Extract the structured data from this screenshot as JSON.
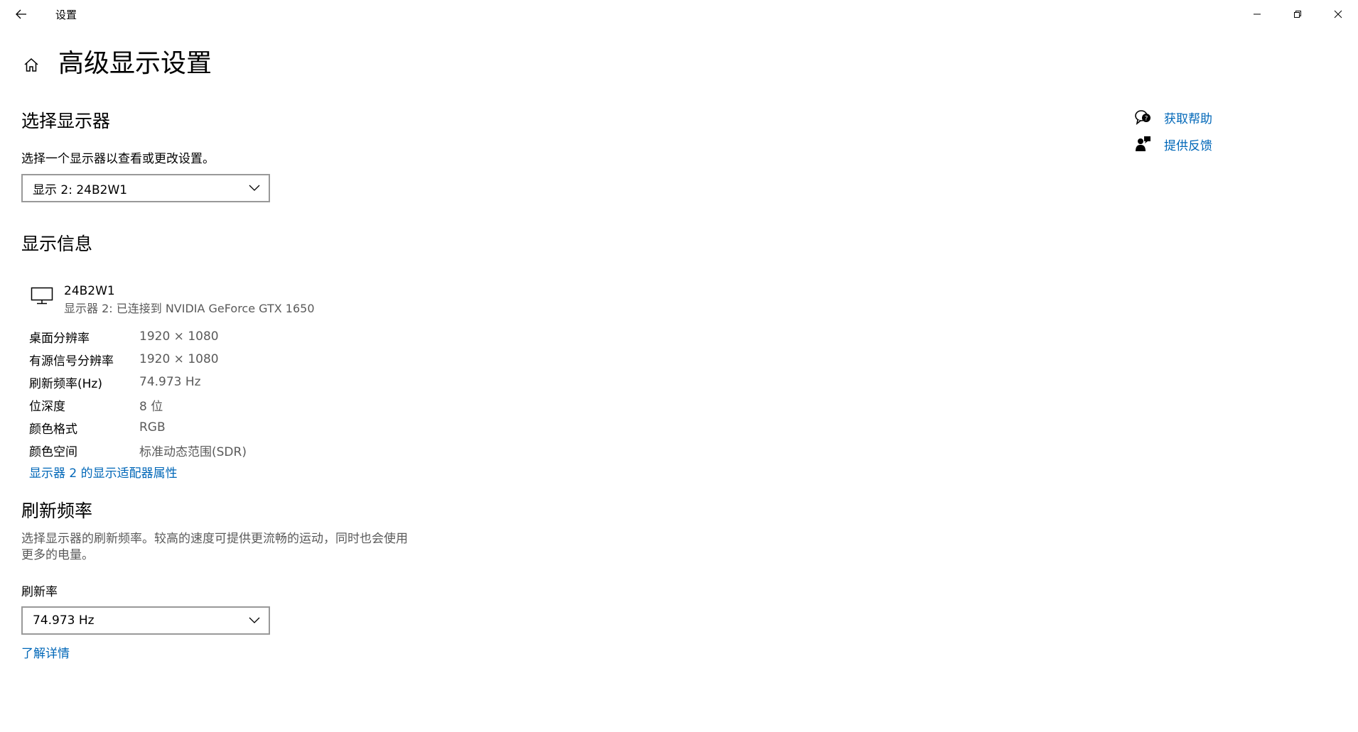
{
  "window": {
    "title": "设置",
    "controls": [
      "minimize",
      "restore",
      "close"
    ]
  },
  "page": {
    "title": "高级显示设置"
  },
  "select_display": {
    "heading": "选择显示器",
    "description": "选择一个显示器以查看或更改设置。",
    "selected": "显示 2: 24B2W1"
  },
  "display_info": {
    "heading": "显示信息",
    "monitor_name": "24B2W1",
    "monitor_subtitle": "显示器 2: 已连接到 NVIDIA GeForce GTX 1650",
    "rows": [
      {
        "key": "桌面分辨率",
        "value": "1920 × 1080"
      },
      {
        "key": "有源信号分辨率",
        "value": "1920 × 1080"
      },
      {
        "key": "刷新频率(Hz)",
        "value": "74.973 Hz"
      },
      {
        "key": "位深度",
        "value": "8 位"
      },
      {
        "key": "颜色格式",
        "value": "RGB"
      },
      {
        "key": "颜色空间",
        "value": "标准动态范围(SDR)"
      }
    ],
    "adapter_link": "显示器 2 的显示适配器属性"
  },
  "refresh": {
    "heading": "刷新频率",
    "description_line1": "选择显示器的刷新频率。较高的速度可提供更流畅的运动，同时也会使用",
    "description_line2": "更多的电量。",
    "label": "刷新率",
    "selected": "74.973 Hz",
    "learn_more": "了解详情"
  },
  "side": {
    "get_help": "获取帮助",
    "give_feedback": "提供反馈"
  },
  "colors": {
    "accent": "#0067b8",
    "secondary_text": "#5a5a5a",
    "dropdown_border": "#999999"
  }
}
